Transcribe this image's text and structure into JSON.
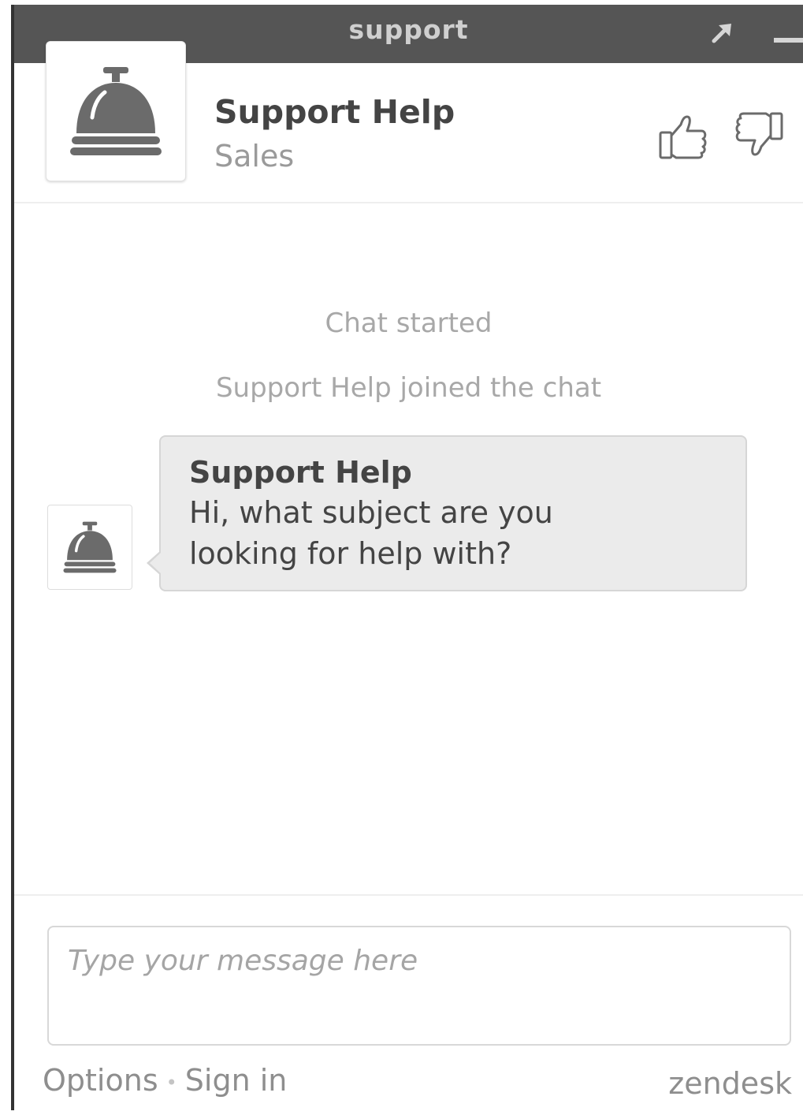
{
  "window": {
    "title": "support",
    "popout_icon": "popout-arrow-icon",
    "minimize_icon": "minimize-icon"
  },
  "header": {
    "agent_name": "Support Help",
    "department": "Sales",
    "avatar_icon": "service-bell-icon",
    "rate_good_icon": "thumbs-up-icon",
    "rate_bad_icon": "thumbs-down-icon"
  },
  "chat": {
    "system_messages": [
      "Chat started",
      "Support Help joined the chat"
    ],
    "messages": [
      {
        "sender": "Support Help",
        "text_line1": "Hi, what subject are you",
        "text_line2": "looking for help with?",
        "avatar_icon": "service-bell-icon"
      }
    ]
  },
  "composer": {
    "placeholder": "Type your message here",
    "value": ""
  },
  "footer": {
    "options_label": "Options",
    "separator": "•",
    "sign_in_label": "Sign in",
    "brand": "zendesk"
  },
  "colors": {
    "titlebar": "#555555",
    "bubble": "#ebebeb",
    "icon": "#6b6b6b"
  }
}
